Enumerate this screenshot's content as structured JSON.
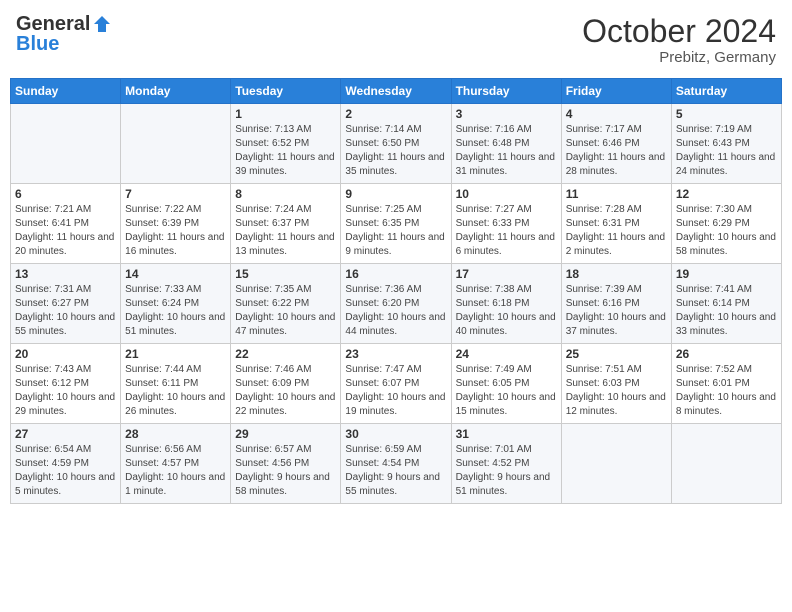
{
  "header": {
    "logo_general": "General",
    "logo_blue": "Blue",
    "month_year": "October 2024",
    "location": "Prebitz, Germany"
  },
  "weekdays": [
    "Sunday",
    "Monday",
    "Tuesday",
    "Wednesday",
    "Thursday",
    "Friday",
    "Saturday"
  ],
  "weeks": [
    [
      {
        "day": null,
        "detail": ""
      },
      {
        "day": null,
        "detail": ""
      },
      {
        "day": "1",
        "detail": "Sunrise: 7:13 AM\nSunset: 6:52 PM\nDaylight: 11 hours and 39 minutes."
      },
      {
        "day": "2",
        "detail": "Sunrise: 7:14 AM\nSunset: 6:50 PM\nDaylight: 11 hours and 35 minutes."
      },
      {
        "day": "3",
        "detail": "Sunrise: 7:16 AM\nSunset: 6:48 PM\nDaylight: 11 hours and 31 minutes."
      },
      {
        "day": "4",
        "detail": "Sunrise: 7:17 AM\nSunset: 6:46 PM\nDaylight: 11 hours and 28 minutes."
      },
      {
        "day": "5",
        "detail": "Sunrise: 7:19 AM\nSunset: 6:43 PM\nDaylight: 11 hours and 24 minutes."
      }
    ],
    [
      {
        "day": "6",
        "detail": "Sunrise: 7:21 AM\nSunset: 6:41 PM\nDaylight: 11 hours and 20 minutes."
      },
      {
        "day": "7",
        "detail": "Sunrise: 7:22 AM\nSunset: 6:39 PM\nDaylight: 11 hours and 16 minutes."
      },
      {
        "day": "8",
        "detail": "Sunrise: 7:24 AM\nSunset: 6:37 PM\nDaylight: 11 hours and 13 minutes."
      },
      {
        "day": "9",
        "detail": "Sunrise: 7:25 AM\nSunset: 6:35 PM\nDaylight: 11 hours and 9 minutes."
      },
      {
        "day": "10",
        "detail": "Sunrise: 7:27 AM\nSunset: 6:33 PM\nDaylight: 11 hours and 6 minutes."
      },
      {
        "day": "11",
        "detail": "Sunrise: 7:28 AM\nSunset: 6:31 PM\nDaylight: 11 hours and 2 minutes."
      },
      {
        "day": "12",
        "detail": "Sunrise: 7:30 AM\nSunset: 6:29 PM\nDaylight: 10 hours and 58 minutes."
      }
    ],
    [
      {
        "day": "13",
        "detail": "Sunrise: 7:31 AM\nSunset: 6:27 PM\nDaylight: 10 hours and 55 minutes."
      },
      {
        "day": "14",
        "detail": "Sunrise: 7:33 AM\nSunset: 6:24 PM\nDaylight: 10 hours and 51 minutes."
      },
      {
        "day": "15",
        "detail": "Sunrise: 7:35 AM\nSunset: 6:22 PM\nDaylight: 10 hours and 47 minutes."
      },
      {
        "day": "16",
        "detail": "Sunrise: 7:36 AM\nSunset: 6:20 PM\nDaylight: 10 hours and 44 minutes."
      },
      {
        "day": "17",
        "detail": "Sunrise: 7:38 AM\nSunset: 6:18 PM\nDaylight: 10 hours and 40 minutes."
      },
      {
        "day": "18",
        "detail": "Sunrise: 7:39 AM\nSunset: 6:16 PM\nDaylight: 10 hours and 37 minutes."
      },
      {
        "day": "19",
        "detail": "Sunrise: 7:41 AM\nSunset: 6:14 PM\nDaylight: 10 hours and 33 minutes."
      }
    ],
    [
      {
        "day": "20",
        "detail": "Sunrise: 7:43 AM\nSunset: 6:12 PM\nDaylight: 10 hours and 29 minutes."
      },
      {
        "day": "21",
        "detail": "Sunrise: 7:44 AM\nSunset: 6:11 PM\nDaylight: 10 hours and 26 minutes."
      },
      {
        "day": "22",
        "detail": "Sunrise: 7:46 AM\nSunset: 6:09 PM\nDaylight: 10 hours and 22 minutes."
      },
      {
        "day": "23",
        "detail": "Sunrise: 7:47 AM\nSunset: 6:07 PM\nDaylight: 10 hours and 19 minutes."
      },
      {
        "day": "24",
        "detail": "Sunrise: 7:49 AM\nSunset: 6:05 PM\nDaylight: 10 hours and 15 minutes."
      },
      {
        "day": "25",
        "detail": "Sunrise: 7:51 AM\nSunset: 6:03 PM\nDaylight: 10 hours and 12 minutes."
      },
      {
        "day": "26",
        "detail": "Sunrise: 7:52 AM\nSunset: 6:01 PM\nDaylight: 10 hours and 8 minutes."
      }
    ],
    [
      {
        "day": "27",
        "detail": "Sunrise: 6:54 AM\nSunset: 4:59 PM\nDaylight: 10 hours and 5 minutes."
      },
      {
        "day": "28",
        "detail": "Sunrise: 6:56 AM\nSunset: 4:57 PM\nDaylight: 10 hours and 1 minute."
      },
      {
        "day": "29",
        "detail": "Sunrise: 6:57 AM\nSunset: 4:56 PM\nDaylight: 9 hours and 58 minutes."
      },
      {
        "day": "30",
        "detail": "Sunrise: 6:59 AM\nSunset: 4:54 PM\nDaylight: 9 hours and 55 minutes."
      },
      {
        "day": "31",
        "detail": "Sunrise: 7:01 AM\nSunset: 4:52 PM\nDaylight: 9 hours and 51 minutes."
      },
      {
        "day": null,
        "detail": ""
      },
      {
        "day": null,
        "detail": ""
      }
    ]
  ]
}
